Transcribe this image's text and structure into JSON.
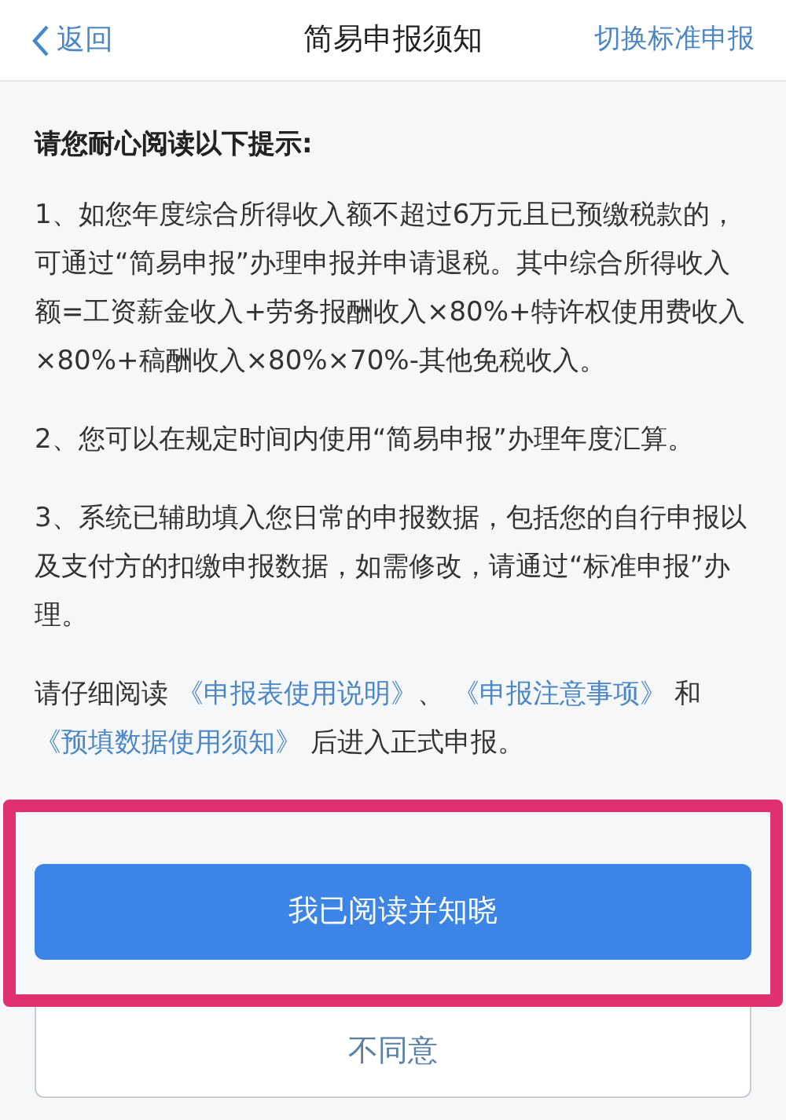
{
  "nav": {
    "back": "返回",
    "title": "简易申报须知",
    "action": "切换标准申报"
  },
  "heading": "请您耐心阅读以下提示:",
  "paragraphs": [
    "1、如您年度综合所得收入额不超过6万元且已预缴税款的，可通过“简易申报”办理申报并申请退税。其中综合所得收入额=工资薪金收入+劳务报酬收入×80%+特许权使用费收入×80%+稿酬收入×80%×70%-其他免税收入。",
    "2、您可以在规定时间内使用“简易申报”办理年度汇算。",
    "3、系统已辅助填入您日常的申报数据，包括您的自行申报以及支付方的扣缴申报数据，如需修改，请通过“标准申报”办理。"
  ],
  "closing": [
    {
      "kind": "text",
      "text": "请仔细阅读 "
    },
    {
      "kind": "link",
      "text": "《申报表使用说明》"
    },
    {
      "kind": "text",
      "text": "、 "
    },
    {
      "kind": "link",
      "text": "《申报注意事项》"
    },
    {
      "kind": "text",
      "text": " 和 "
    },
    {
      "kind": "link",
      "text": "《预填数据使用须知》"
    },
    {
      "kind": "text",
      "text": " 后进入正式申报。"
    }
  ],
  "buttons": {
    "confirm": "我已阅读并知晓",
    "decline": "不同意"
  }
}
